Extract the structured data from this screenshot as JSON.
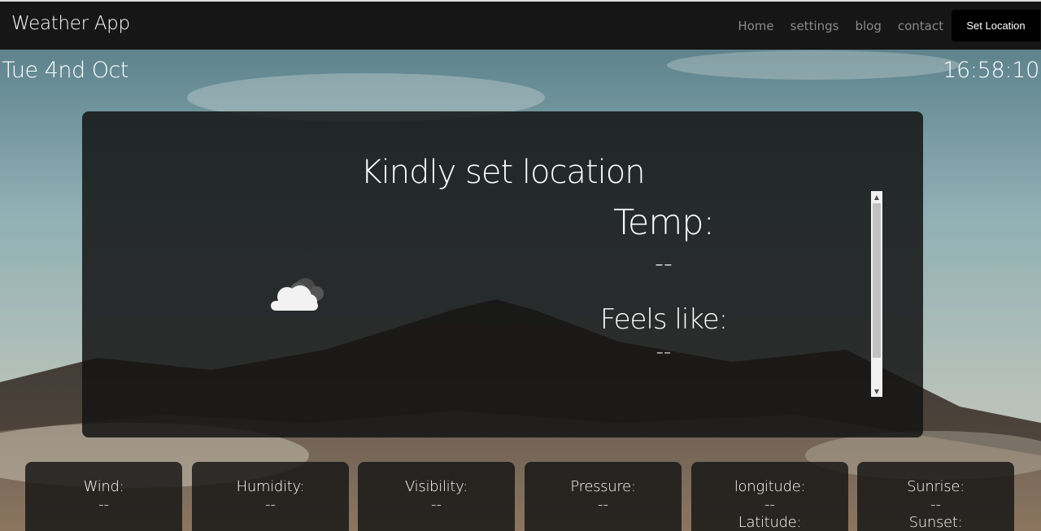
{
  "navbar": {
    "brand": "Weather App",
    "links": [
      "Home",
      "settings",
      "blog",
      "contact"
    ],
    "set_location_label": "Set Location"
  },
  "header": {
    "date": "Tue 4nd Oct",
    "time": "16:58:10"
  },
  "main_card": {
    "location_title": "Kindly set location",
    "weather_icon": "cloud-icon",
    "temp_label": "Temp:",
    "temp_value": "--",
    "feels_label": "Feels like:",
    "feels_value": "--"
  },
  "info_cards": [
    {
      "label": "Wind:",
      "value": "--"
    },
    {
      "label": "Humidity:",
      "value": "--"
    },
    {
      "label": "Visibility:",
      "value": "--"
    },
    {
      "label": "Pressure:",
      "value": "--"
    },
    {
      "label": "longitude:",
      "value": "--",
      "label2": "Latitude:"
    },
    {
      "label": "Sunrise:",
      "value": "--",
      "label2": "Sunset:"
    }
  ],
  "colors": {
    "navbar_bg": "#161616",
    "nav_link": "#8a8a8a",
    "button_bg": "#000000",
    "card_bg": "#141414"
  }
}
